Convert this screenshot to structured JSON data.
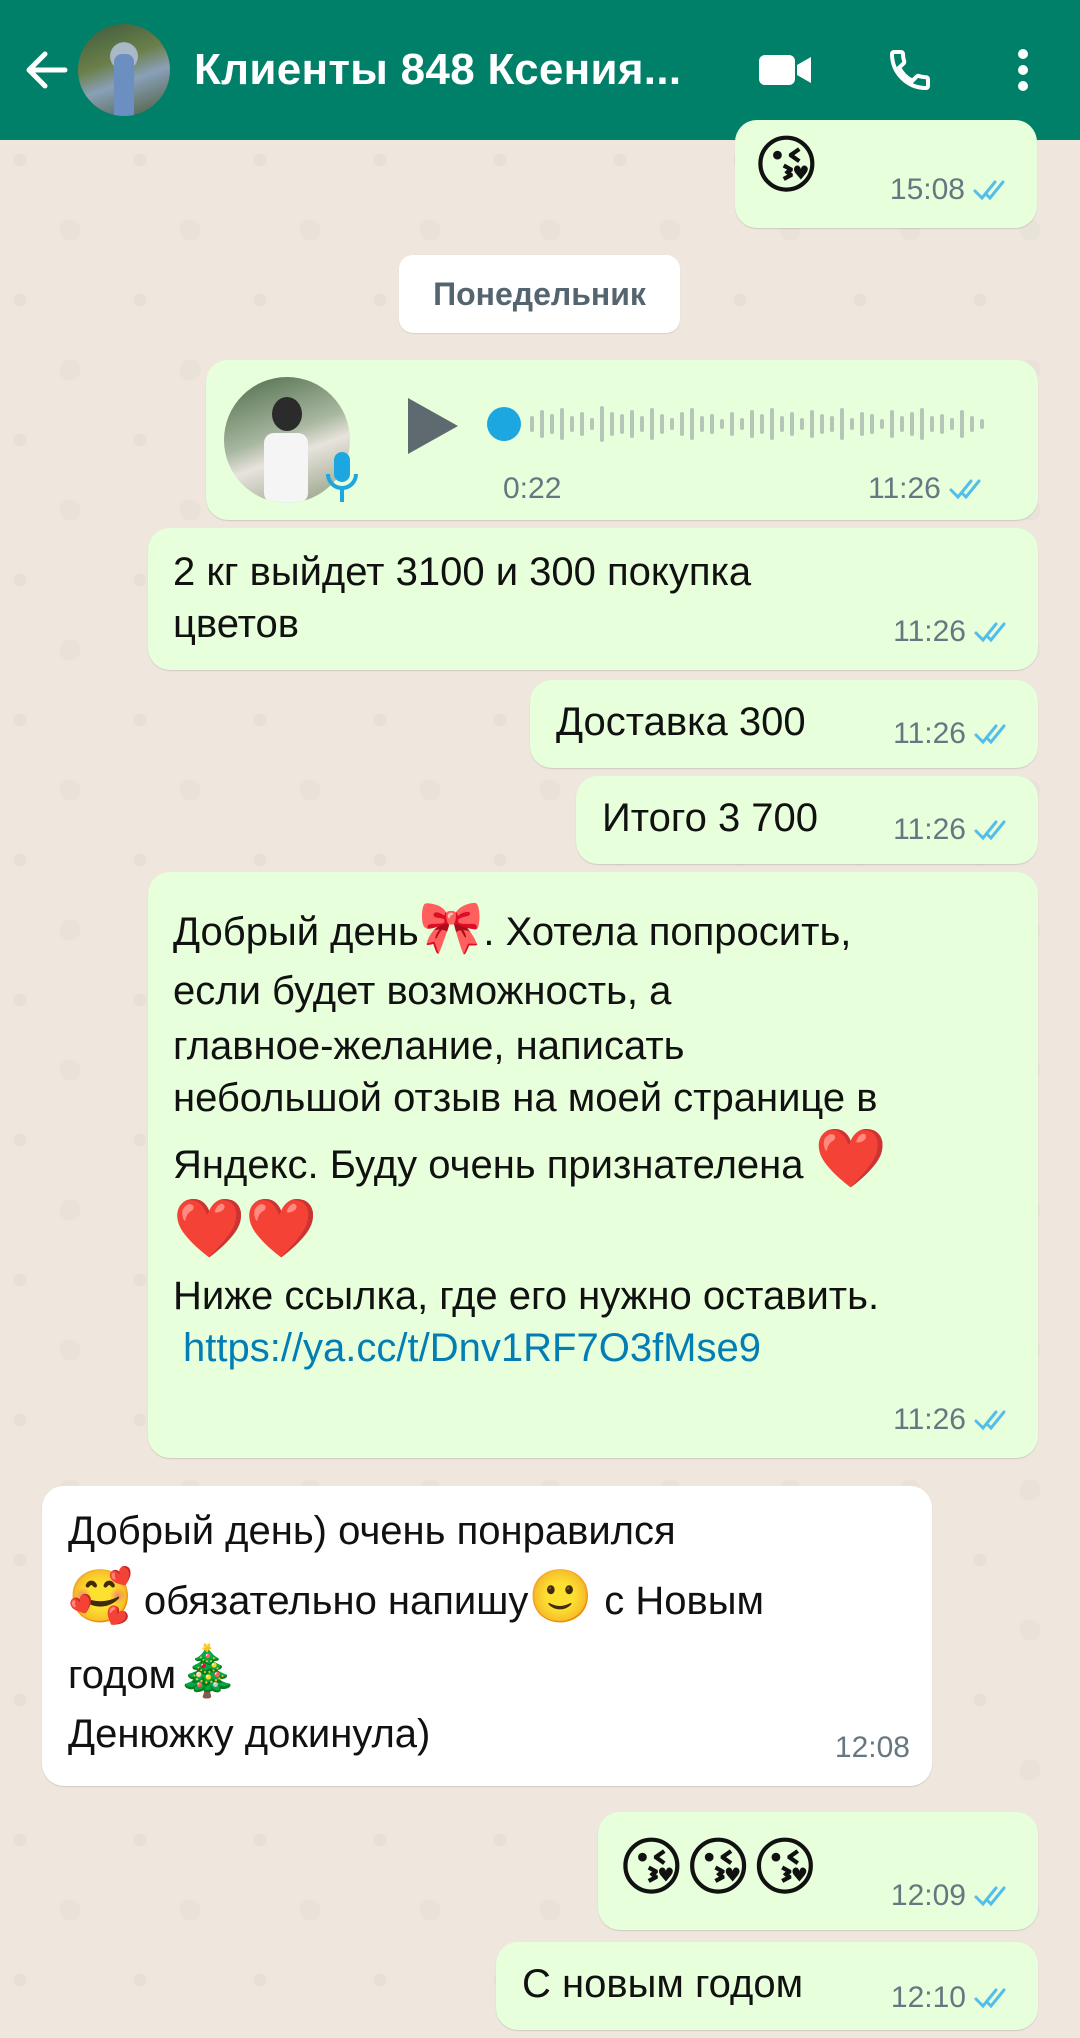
{
  "header": {
    "title": "Клиенты 848 Ксения...",
    "bg_color": "#008069"
  },
  "date_divider": "Понедельник",
  "messages": [
    {
      "emoji": "😘",
      "time": "15:08",
      "direction": "out"
    },
    {
      "type": "voice",
      "duration": "0:22",
      "time": "11:26",
      "direction": "out"
    },
    {
      "lines": [
        "2 кг выйдет 3100 и 300 покупка",
        "цветов"
      ],
      "time": "11:26",
      "direction": "out"
    },
    {
      "text": "Доставка 300",
      "time": "11:26",
      "direction": "out"
    },
    {
      "text": "Итого 3 700",
      "time": "11:26",
      "direction": "out"
    },
    {
      "line1_a": "Добрый день",
      "line1_emoji": "🎀",
      "line1_b": ".  Хотела попросить,",
      "line2": "если будет возможность,  а",
      "line3": "главное-желание,  написать",
      "line4": "небольшой отзыв на моей странице в",
      "line5": "Яндекс.  Буду очень признателена",
      "line5_emoji": "❤️",
      "line6_emoji": "❤️❤️",
      "line7": "Ниже ссылка, где его нужно оставить.",
      "link": "https://ya.cc/t/Dnv1RF7O3fMse9",
      "time": "11:26",
      "direction": "out"
    },
    {
      "line1": "Добрый день) очень понравился",
      "line2_emoji_a": "🥰",
      "line2": " обязательно напишу",
      "line2_emoji_b": "🙂",
      "line2_c": " с Новым",
      "line3": "годом",
      "line3_emoji": "🎄",
      "line4": "Денюжку докинула)",
      "time": "12:08",
      "direction": "in"
    },
    {
      "emoji": "😘😘😘",
      "time": "12:09",
      "direction": "out"
    },
    {
      "text": "С новым годом",
      "time": "12:10",
      "direction": "out"
    }
  ],
  "colors": {
    "outgoing_bubble": "#E7FFDB",
    "incoming_bubble": "#FFFFFF",
    "read_ticks": "#53BDEB",
    "chat_background": "#EFE7DE"
  }
}
